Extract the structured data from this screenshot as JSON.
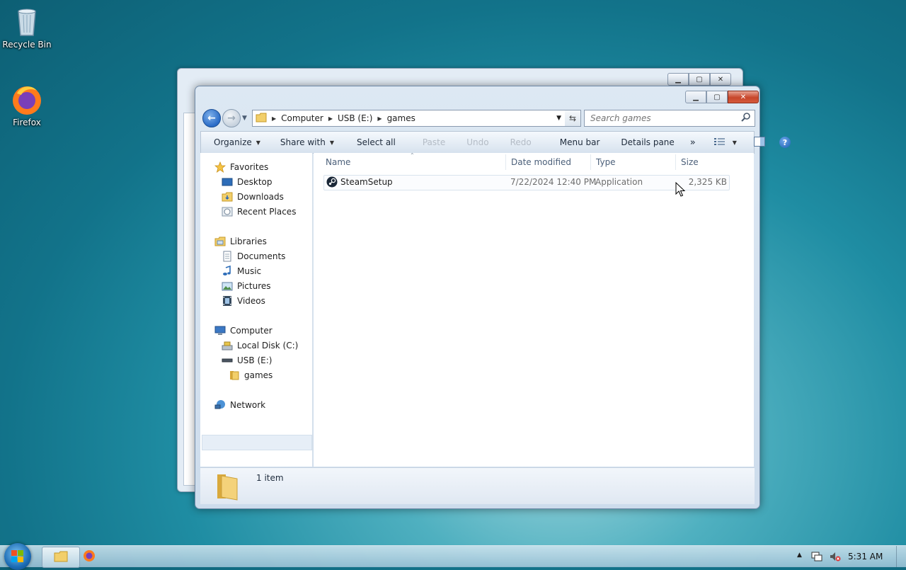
{
  "desktop": {
    "icons": [
      {
        "label": "Recycle Bin",
        "icon": "recycle-bin-icon"
      },
      {
        "label": "Firefox",
        "icon": "firefox-icon"
      }
    ]
  },
  "window": {
    "address": {
      "segments": [
        "Computer",
        "USB (E:)",
        "games"
      ]
    },
    "search": {
      "placeholder": "Search games"
    },
    "toolbar": {
      "organize": "Organize",
      "share_with": "Share with",
      "select_all": "Select all",
      "paste": "Paste",
      "undo": "Undo",
      "redo": "Redo",
      "menu_bar": "Menu bar",
      "details_pane": "Details pane",
      "more": "»"
    },
    "nav": {
      "favorites": "Favorites",
      "desktop": "Desktop",
      "downloads": "Downloads",
      "recent_places": "Recent Places",
      "libraries": "Libraries",
      "documents": "Documents",
      "music": "Music",
      "pictures": "Pictures",
      "videos": "Videos",
      "computer": "Computer",
      "local_disk": "Local Disk (C:)",
      "usb": "USB (E:)",
      "games": "games",
      "network": "Network"
    },
    "columns": {
      "name": "Name",
      "date_modified": "Date modified",
      "type": "Type",
      "size": "Size"
    },
    "files": [
      {
        "name": "SteamSetup",
        "date_modified": "7/22/2024 12:40 PM",
        "type": "Application",
        "size": "2,325 KB"
      }
    ],
    "details": {
      "count": "1 item"
    }
  },
  "taskbar": {
    "clock": "5:31 AM"
  }
}
